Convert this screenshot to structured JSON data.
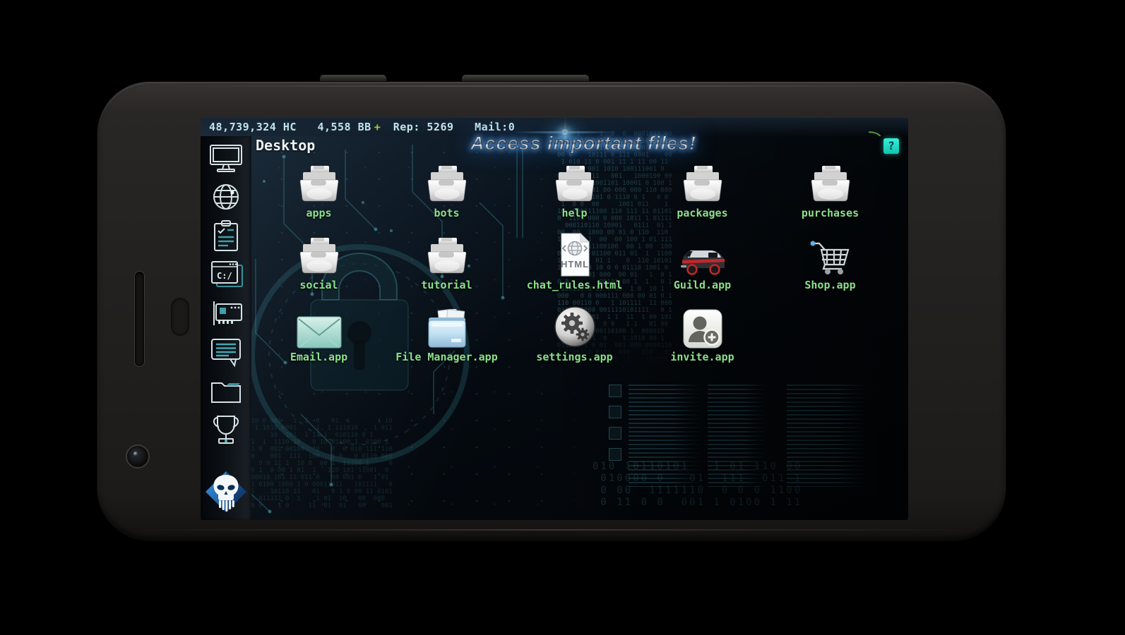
{
  "status_bar": {
    "hc": "48,739,324 HC",
    "bb": "4,558 BB",
    "plus": "+",
    "rep": "Rep: 5269",
    "mail": "Mail:0"
  },
  "header": {
    "title": "Desktop",
    "banner": "Access important files!",
    "help": "?"
  },
  "sidebar": {
    "console_text": "C:/",
    "items": [
      {
        "icon": "desktop-monitor-icon"
      },
      {
        "icon": "network-globe-icon"
      },
      {
        "icon": "missions-clipboard-icon"
      },
      {
        "icon": "console-terminal-icon"
      },
      {
        "icon": "hardware-card-icon"
      },
      {
        "icon": "chat-bubble-icon"
      },
      {
        "icon": "files-folder-icon"
      },
      {
        "icon": "ranking-trophy-icon"
      },
      {
        "icon": "hackers-skull-logo"
      }
    ]
  },
  "desktop": {
    "html_badge": "HTML",
    "items": [
      {
        "label": "apps",
        "icon": "folder-icon"
      },
      {
        "label": "bots",
        "icon": "folder-icon"
      },
      {
        "label": "help",
        "icon": "folder-icon"
      },
      {
        "label": "packages",
        "icon": "folder-icon"
      },
      {
        "label": "purchases",
        "icon": "folder-icon"
      },
      {
        "label": "social",
        "icon": "folder-icon"
      },
      {
        "label": "tutorial",
        "icon": "folder-icon"
      },
      {
        "label": "chat_rules.html",
        "icon": "html-file-icon"
      },
      {
        "label": "Guild.app",
        "icon": "guild-van-icon"
      },
      {
        "label": "Shop.app",
        "icon": "shopping-cart-icon"
      },
      {
        "label": "Email.app",
        "icon": "email-envelope-icon"
      },
      {
        "label": "File Manager.app",
        "icon": "file-manager-folder-icon"
      },
      {
        "label": "settings.app",
        "icon": "settings-gears-icon"
      },
      {
        "label": "invite.app",
        "icon": "invite-person-icon"
      }
    ]
  },
  "colors": {
    "label_green": "#8ce08a",
    "status_cyan": "#c2e4ec",
    "plus_green": "#a6c83b",
    "teal_accent": "#49b8c4",
    "help_teal": "#1ee0c8",
    "logo_blue": "#2f85d6"
  }
}
